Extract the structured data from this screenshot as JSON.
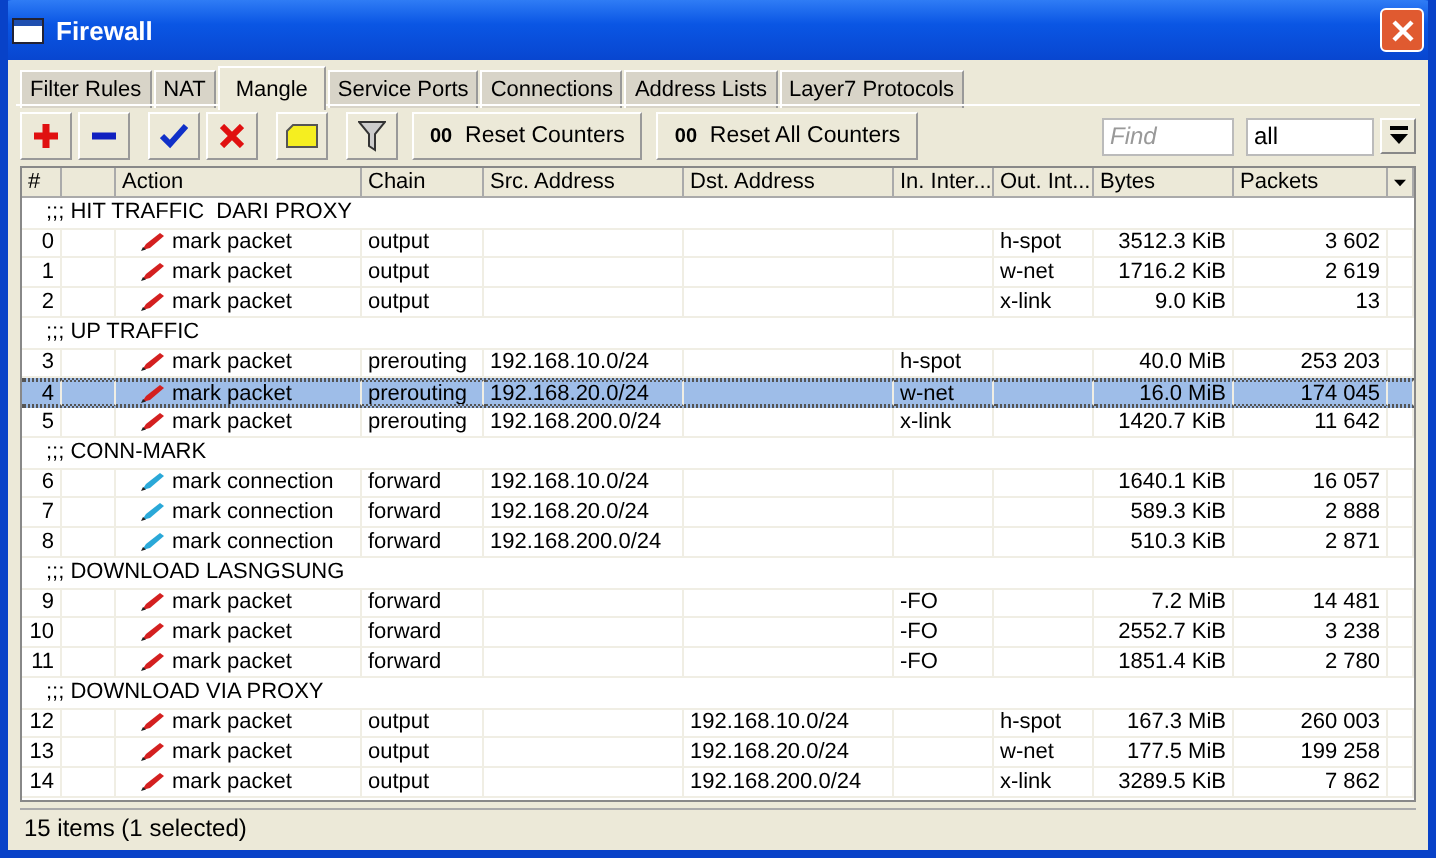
{
  "window": {
    "title": "Firewall"
  },
  "tabs": [
    {
      "label": "Filter Rules",
      "selected": false
    },
    {
      "label": "NAT",
      "selected": false
    },
    {
      "label": "Mangle",
      "selected": true
    },
    {
      "label": "Service Ports",
      "selected": false
    },
    {
      "label": "Connections",
      "selected": false
    },
    {
      "label": "Address Lists",
      "selected": false
    },
    {
      "label": "Layer7 Protocols",
      "selected": false
    }
  ],
  "toolbar": {
    "tools": [
      {
        "kind": "add"
      },
      {
        "kind": "remove"
      },
      {
        "kind": "enable"
      },
      {
        "kind": "disable"
      },
      {
        "kind": "comment"
      },
      {
        "kind": "filter"
      }
    ],
    "buttons": [
      {
        "icon": "00",
        "label": "Reset Counters"
      },
      {
        "icon": "00",
        "label": "Reset All Counters"
      }
    ],
    "search": {
      "placeholder": "Find"
    },
    "filter_select": {
      "value": "all"
    }
  },
  "table": {
    "columns": [
      "#",
      "Action",
      "Chain",
      "Src. Address",
      "Dst. Address",
      "In. Inter...",
      "Out. Int...",
      "Bytes",
      "Packets"
    ],
    "rows": [
      {
        "kind": "comment",
        "text": ";;; HIT TRAFFIC  DARI PROXY"
      },
      {
        "kind": "rule",
        "num": "0",
        "action": "mark packet",
        "color": "#d42020",
        "chain": "output",
        "out": "h-spot",
        "bytes": "3512.3 KiB",
        "packets": "3 602",
        "selected": false
      },
      {
        "kind": "rule",
        "num": "1",
        "action": "mark packet",
        "color": "#d42020",
        "chain": "output",
        "out": "w-net",
        "bytes": "1716.2 KiB",
        "packets": "2 619",
        "selected": false
      },
      {
        "kind": "rule",
        "num": "2",
        "action": "mark packet",
        "color": "#d42020",
        "chain": "output",
        "out": "x-link",
        "bytes": "9.0 KiB",
        "packets": "13",
        "selected": false
      },
      {
        "kind": "comment",
        "text": ";;; UP TRAFFIC"
      },
      {
        "kind": "rule",
        "num": "3",
        "action": "mark packet",
        "color": "#d42020",
        "chain": "prerouting",
        "src": "192.168.10.0/24",
        "in": "h-spot",
        "bytes": "40.0 MiB",
        "packets": "253 203",
        "selected": false
      },
      {
        "kind": "rule",
        "num": "4",
        "action": "mark packet",
        "color": "#d42020",
        "chain": "prerouting",
        "src": "192.168.20.0/24",
        "in": "w-net",
        "bytes": "16.0 MiB",
        "packets": "174 045",
        "selected": true
      },
      {
        "kind": "rule",
        "num": "5",
        "action": "mark packet",
        "color": "#d42020",
        "chain": "prerouting",
        "src": "192.168.200.0/24",
        "in": "x-link",
        "bytes": "1420.7 KiB",
        "packets": "11 642",
        "selected": false
      },
      {
        "kind": "comment",
        "text": ";;; CONN-MARK"
      },
      {
        "kind": "rule",
        "num": "6",
        "action": "mark connection",
        "color": "#2aa8d8",
        "chain": "forward",
        "src": "192.168.10.0/24",
        "bytes": "1640.1 KiB",
        "packets": "16 057",
        "selected": false
      },
      {
        "kind": "rule",
        "num": "7",
        "action": "mark connection",
        "color": "#2aa8d8",
        "chain": "forward",
        "src": "192.168.20.0/24",
        "bytes": "589.3 KiB",
        "packets": "2 888",
        "selected": false
      },
      {
        "kind": "rule",
        "num": "8",
        "action": "mark connection",
        "color": "#2aa8d8",
        "chain": "forward",
        "src": "192.168.200.0/24",
        "bytes": "510.3 KiB",
        "packets": "2 871",
        "selected": false
      },
      {
        "kind": "comment",
        "text": ";;; DOWNLOAD LASNGSUNG"
      },
      {
        "kind": "rule",
        "num": "9",
        "action": "mark packet",
        "color": "#d42020",
        "chain": "forward",
        "in": "-FO",
        "bytes": "7.2 MiB",
        "packets": "14 481",
        "selected": false
      },
      {
        "kind": "rule",
        "num": "10",
        "action": "mark packet",
        "color": "#d42020",
        "chain": "forward",
        "in": "-FO",
        "bytes": "2552.7 KiB",
        "packets": "3 238",
        "selected": false
      },
      {
        "kind": "rule",
        "num": "11",
        "action": "mark packet",
        "color": "#d42020",
        "chain": "forward",
        "in": "-FO",
        "bytes": "1851.4 KiB",
        "packets": "2 780",
        "selected": false
      },
      {
        "kind": "comment",
        "text": ";;; DOWNLOAD VIA PROXY"
      },
      {
        "kind": "rule",
        "num": "12",
        "action": "mark packet",
        "color": "#d42020",
        "chain": "output",
        "dst": "192.168.10.0/24",
        "out": "h-spot",
        "bytes": "167.3 MiB",
        "packets": "260 003",
        "selected": false
      },
      {
        "kind": "rule",
        "num": "13",
        "action": "mark packet",
        "color": "#d42020",
        "chain": "output",
        "dst": "192.168.20.0/24",
        "out": "w-net",
        "bytes": "177.5 MiB",
        "packets": "199 258",
        "selected": false
      },
      {
        "kind": "rule",
        "num": "14",
        "action": "mark packet",
        "color": "#d42020",
        "chain": "output",
        "dst": "192.168.200.0/24",
        "out": "x-link",
        "bytes": "3289.5 KiB",
        "packets": "7 862",
        "selected": false
      }
    ]
  },
  "status_bar": {
    "text": "15 items (1 selected)"
  }
}
